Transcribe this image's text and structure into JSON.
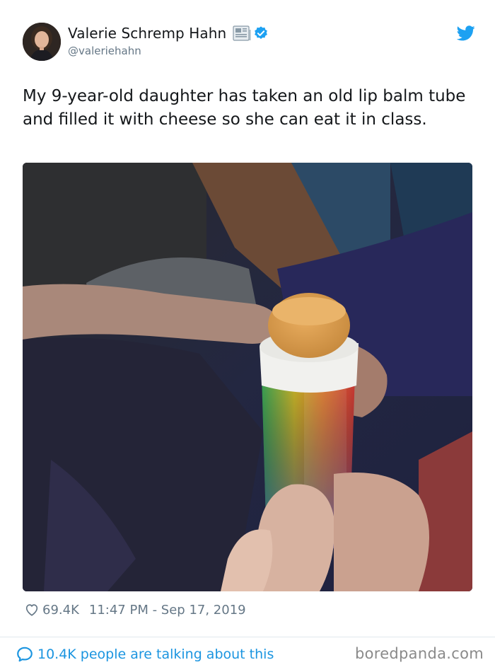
{
  "author": {
    "name": "Valerie Schremp Hahn",
    "handle": "@valeriehahn",
    "avatar_icon": "person-portrait-avatar",
    "badge_icons": [
      "newspaper-icon",
      "verified-check-icon"
    ],
    "verified_color": "#1da1f2"
  },
  "platform_icon": "twitter-bird-icon",
  "tweet": {
    "text": "My 9-year-old daughter has taken an old lip balm tube and filled it with cheese so she can eat it in class.",
    "photo": {
      "subject": "hand holding rainbow lip balm tube filled with orange cheese"
    }
  },
  "meta": {
    "likes": "69.4K",
    "timestamp": "11:47 PM - Sep 17, 2019"
  },
  "footer": {
    "conversation_text": "10.4K people are talking about this",
    "watermark": "boredpanda.com"
  },
  "colors": {
    "link_blue": "#1b95e0",
    "text_primary": "#14171a",
    "text_secondary": "#657786",
    "divider": "#e1e8ed"
  }
}
